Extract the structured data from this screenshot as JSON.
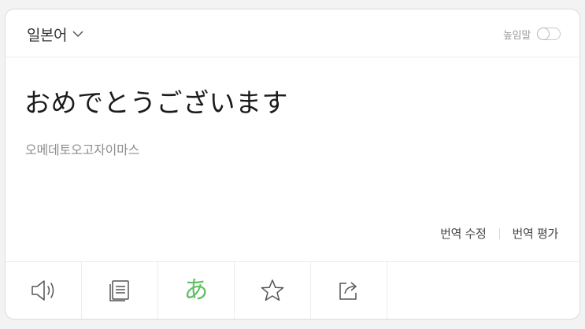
{
  "header": {
    "language": "일본어",
    "honorific_label": "높임말",
    "honorific_on": false
  },
  "result": {
    "translation": "おめでとうございます",
    "pronunciation": "오메데토오고자이마스"
  },
  "actions": {
    "edit_label": "번역 수정",
    "rate_label": "번역 평가"
  },
  "toolbar": {
    "icons": [
      "speaker-icon",
      "copy-icon",
      "kana-icon",
      "star-icon",
      "share-icon"
    ],
    "kana_glyph": "あ",
    "kana_color": "#5fbf62"
  }
}
